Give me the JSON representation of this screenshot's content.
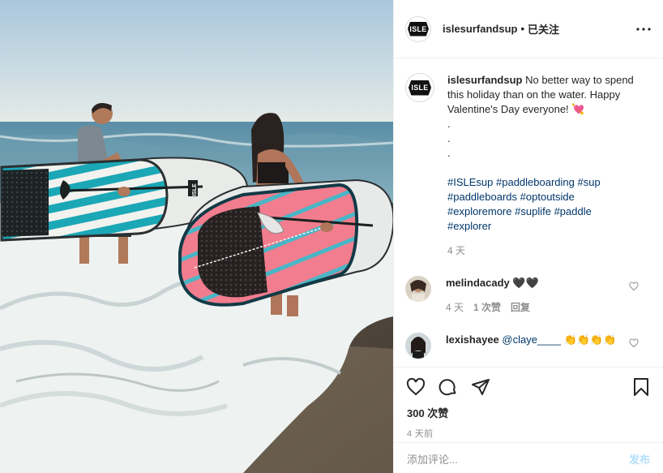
{
  "header": {
    "username": "islesurfandsup",
    "dot": "•",
    "follow_status": "已关注",
    "more_icon": "more-horizontal-icon",
    "avatar_text": "ISLE"
  },
  "caption": {
    "username": "islesurfandsup",
    "text": "No better way to spend this holiday than on the water. Happy Valentine's Day everyone! 💘",
    "dots": [
      ".",
      ".",
      "."
    ],
    "tags": [
      "#ISLEsup",
      "#paddleboarding",
      "#sup",
      "#paddleboards",
      "#optoutside",
      "#exploremore",
      "#suplife",
      "#paddle",
      "#explorer"
    ],
    "time": "4 天"
  },
  "comments": [
    {
      "username": "melindacady",
      "text": "🖤🖤",
      "time": "4 天",
      "likes": "1 次赞",
      "reply": "回复"
    },
    {
      "username": "lexishayee",
      "mention": "@claye____",
      "text": "👏👏👏👏"
    }
  ],
  "actions": {
    "like_icon": "heart-outline-icon",
    "comment_icon": "comment-bubble-icon",
    "share_icon": "paper-plane-icon",
    "save_icon": "bookmark-icon"
  },
  "likes": "300 次赞",
  "posted_ago": "4 天前",
  "composer": {
    "placeholder": "添加评论...",
    "post_label": "发布"
  },
  "colors": {
    "link": "#00376b",
    "muted": "#8e8e8e",
    "post_button_disabled": "#b2dffc",
    "border": "#efefef"
  },
  "photo": {
    "board_front_brand": "ISLE",
    "board_back_brand": "ISLE"
  }
}
